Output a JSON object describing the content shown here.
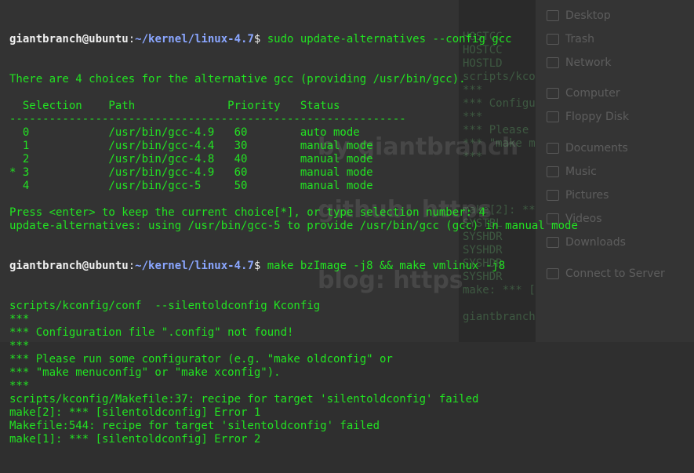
{
  "background": {
    "residue_lines": [
      "",
      "HOSTCC",
      "HOSTCC",
      "HOSTLD",
      "scripts/kco",
      "***",
      "*** Configu",
      "***",
      "*** Please",
      "*** \"make m",
      "***",
      "",
      "",
      "",
      "make[2]: **",
      "SYSTBL",
      "SYSHDR",
      "SYSHDR",
      "SYSHDR",
      "SYSHDR",
      "make: *** [",
      "",
      "giantbranch"
    ],
    "watermarks": {
      "by": "by giantbranch",
      "github": "github: https",
      "blog": "blog: https"
    }
  },
  "file_manager": {
    "items": [
      {
        "label": "Desktop",
        "icon": "desktop-icon"
      },
      {
        "label": "Trash",
        "icon": "trash-icon"
      },
      {
        "label": "Network",
        "icon": "network-icon"
      },
      {
        "label": "Computer",
        "icon": "computer-icon"
      },
      {
        "label": "Floppy Disk",
        "icon": "floppy-icon"
      },
      {
        "label": "Documents",
        "icon": "folder-icon"
      },
      {
        "label": "Music",
        "icon": "folder-icon"
      },
      {
        "label": "Pictures",
        "icon": "folder-icon"
      },
      {
        "label": "Videos",
        "icon": "folder-icon"
      },
      {
        "label": "Downloads",
        "icon": "folder-icon"
      },
      {
        "label": "Connect to Server",
        "icon": "server-icon"
      }
    ]
  },
  "terminal": {
    "prompt": {
      "user_host": "giantbranch@ubuntu",
      "colon": ":",
      "cwd": "~/kernel/linux-4.7",
      "symbol": "$ "
    },
    "cmd1": "sudo update-alternatives --config gcc",
    "out1": [
      "There are 4 choices for the alternative gcc (providing /usr/bin/gcc).",
      "",
      "  Selection    Path              Priority   Status",
      "------------------------------------------------------------",
      "  0            /usr/bin/gcc-4.9   60        auto mode",
      "  1            /usr/bin/gcc-4.4   30        manual mode",
      "  2            /usr/bin/gcc-4.8   40        manual mode",
      "* 3            /usr/bin/gcc-4.9   60        manual mode",
      "  4            /usr/bin/gcc-5     50        manual mode",
      "",
      "Press <enter> to keep the current choice[*], or type selection number: 4",
      "update-alternatives: using /usr/bin/gcc-5 to provide /usr/bin/gcc (gcc) in manual mode"
    ],
    "cmd2": "make bzImage -j8 && make vmlinux -j8",
    "out2": [
      "scripts/kconfig/conf  --silentoldconfig Kconfig",
      "***",
      "*** Configuration file \".config\" not found!",
      "***",
      "*** Please run some configurator (e.g. \"make oldconfig\" or",
      "*** \"make menuconfig\" or \"make xconfig\").",
      "***",
      "scripts/kconfig/Makefile:37: recipe for target 'silentoldconfig' failed",
      "make[2]: *** [silentoldconfig] Error 1",
      "Makefile:544: recipe for target 'silentoldconfig' failed",
      "make[1]: *** [silentoldconfig] Error 2"
    ]
  },
  "colors": {
    "terminal_text": "#22e222",
    "prompt_user": "#f0f0f0",
    "prompt_path": "#8aa6ff",
    "background": "#333333"
  }
}
